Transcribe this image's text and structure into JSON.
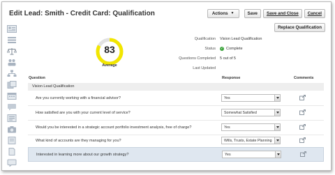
{
  "header": {
    "title": "Edit Lead: Smith - Credit Card: Qualification",
    "actions_label": "Actions",
    "save_label": "Save",
    "save_close_label": "Save and Close",
    "cancel_label": "Cancel"
  },
  "replace_label": "Replace Qualification",
  "score": {
    "value": "83",
    "label": "Average",
    "fraction": 0.83,
    "color": "#f2e600"
  },
  "info": {
    "qualification_label": "Qualification",
    "qualification_value": "Vision Lead Qualification",
    "status_label": "Status",
    "status_value": "Complete",
    "completed_label": "Questions Completed",
    "completed_value": "5 out of 5",
    "updated_label": "Last Updated",
    "updated_value": ""
  },
  "table": {
    "col_question": "Question",
    "col_response": "Response",
    "col_comments": "Comments",
    "group": "Vision Lead Qualification",
    "rows": [
      {
        "question": "Are you currently working with a financial advisor?",
        "response": "Yes"
      },
      {
        "question": "How satisfied are you with your current level of service?",
        "response": "Somewhat Satisfied"
      },
      {
        "question": "Would you be interested in a strategic account portfolio investment analysis, free of charge?",
        "response": "Yes"
      },
      {
        "question": "What kind of accounts are they managing for you?",
        "response": "Wills, Trusts, Estate Planning"
      },
      {
        "question": "Interested in learning more about our growth strategy?",
        "response": "Yes"
      }
    ]
  },
  "sidebar": {
    "icons": [
      "profile-card-icon",
      "list-icon",
      "scales-icon",
      "people-icon",
      "org-chart-icon",
      "documents-icon",
      "calendar-icon",
      "chat-icon",
      "contacts-icon",
      "camera-icon",
      "notes-icon",
      "page-icon",
      "message-icon"
    ]
  }
}
